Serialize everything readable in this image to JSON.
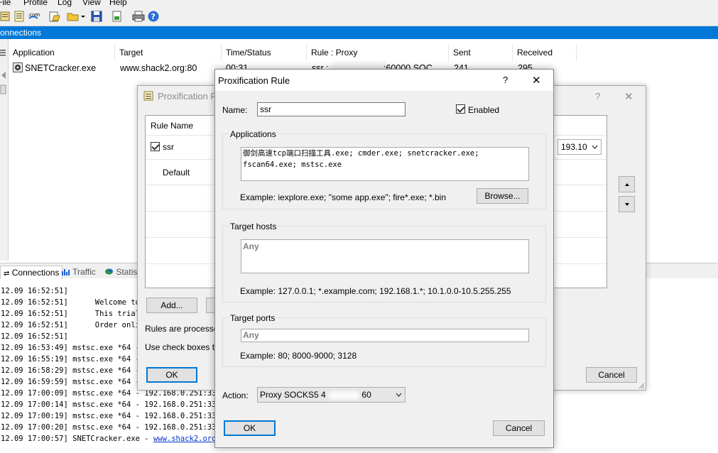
{
  "menu": [
    "File",
    "Profile",
    "Log",
    "View",
    "Help"
  ],
  "connections_title": "onnections",
  "columns": [
    "Application",
    "Target",
    "Time/Status",
    "Rule : Proxy",
    "Sent",
    "Received"
  ],
  "row": {
    "app": "SNETCracker.exe",
    "target": "www.shack2.org:80",
    "time": "00:31",
    "rule_a": "ssr :",
    "rule_b": ":60000 SOC…",
    "sent": "241",
    "received": "295"
  },
  "tabs": {
    "connections": "Connections",
    "traffic": "Traffic",
    "statistics": "Statist"
  },
  "log_lines": [
    "12.09 16:52:51]",
    "12.09 16:52:51]      Welcome to P",
    "12.09 16:52:51]      This trial v",
    "12.09 16:52:51]      Order online",
    "12.09 16:52:51]",
    "12.09 16:53:49] mstsc.exe *64 -",
    "12.09 16:55:19] mstsc.exe *64 -",
    "12.09 16:58:29] mstsc.exe *64 -",
    "12.09 16:59:59] mstsc.exe *64 -",
    "12.09 17:00:09] mstsc.exe *64 - 192.168.0.251:3389",
    "12.09 17:00:14] mstsc.exe *64 - 192.168.0.251:3389",
    "12.09 17:00:19] mstsc.exe *64 - 192.168.0.251:3389",
    "12.09 17:00:20] mstsc.exe *64 - 192.168.0.251:3389"
  ],
  "log_last": {
    "prefix": "12.09 17:00:57] SNETCracker.exe - ",
    "link": "www.shack2.org:80"
  },
  "rules_dialog": {
    "title": "Proxification R",
    "help": "?",
    "close": "✕",
    "col_rule_name": "Rule Name",
    "rules": [
      "ssr",
      "Default"
    ],
    "proxy_value": "193.10",
    "add_label": "Add...",
    "text1": "Rules are processed",
    "text2": "Use check boxes to e",
    "ok_label": "OK",
    "cancel_label": "Cancel"
  },
  "rule_dialog": {
    "title": "Proxification Rule",
    "help": "?",
    "close": "✕",
    "name_label": "Name:",
    "name_value": "ssr",
    "enabled_label": "Enabled",
    "applications_label": "Applications",
    "applications_line1": "御剑高速tcp端口扫描工具.exe; cmder.exe; snetcracker.exe;",
    "applications_line2": "fscan64.exe; mstsc.exe",
    "applications_example": "Example: iexplore.exe; \"some app.exe\"; fire*.exe; *.bin",
    "browse_label": "Browse...",
    "hosts_label": "Target hosts",
    "hosts_value": "Any",
    "hosts_example": "Example: 127.0.0.1; *.example.com; 192.168.1.*; 10.1.0.0-10.5.255.255",
    "ports_label": "Target ports",
    "ports_value": "Any",
    "ports_example": "Example: 80; 8000-9000; 3128",
    "action_label": "Action:",
    "action_value_a": "Proxy SOCKS5 4",
    "action_value_b": "60",
    "ok_label": "OK",
    "cancel_label": "Cancel"
  }
}
